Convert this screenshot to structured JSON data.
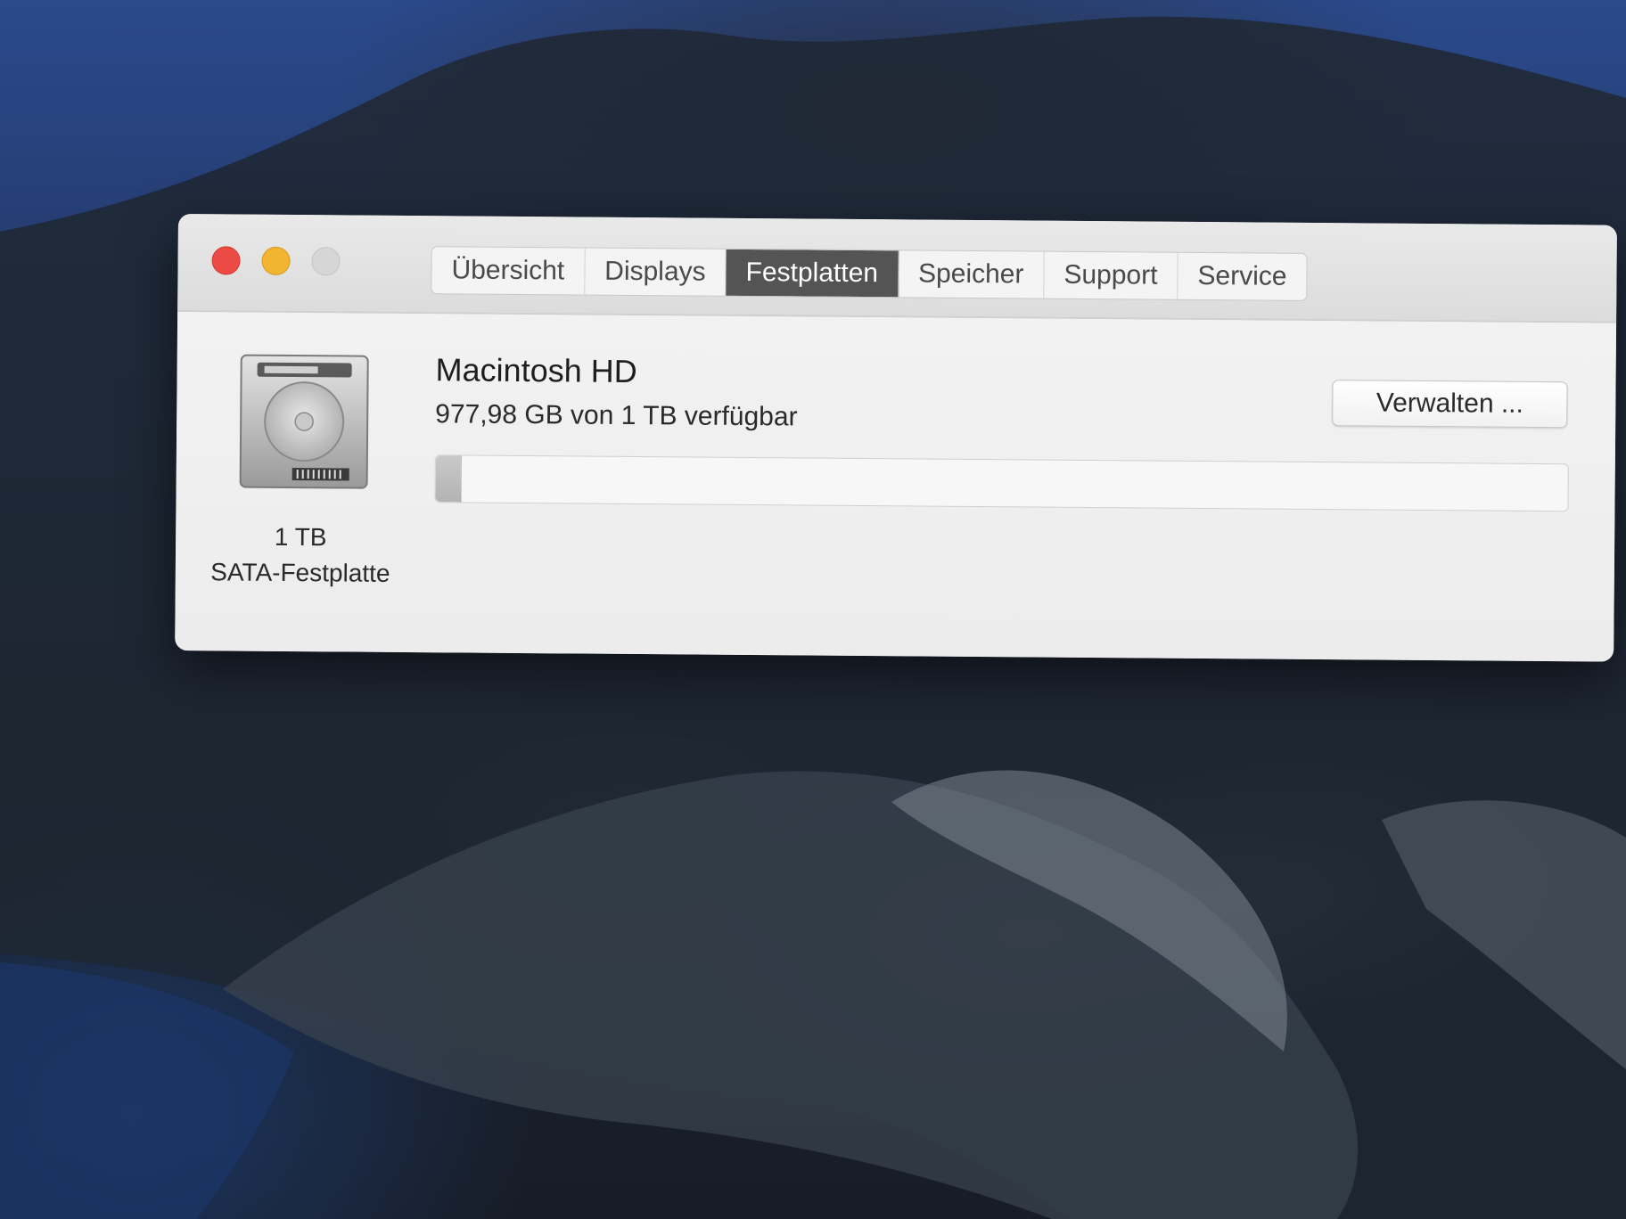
{
  "window": {
    "tabs": [
      {
        "label": "Übersicht",
        "active": false
      },
      {
        "label": "Displays",
        "active": false
      },
      {
        "label": "Festplatten",
        "active": true
      },
      {
        "label": "Speicher",
        "active": false
      },
      {
        "label": "Support",
        "active": false
      },
      {
        "label": "Service",
        "active": false
      }
    ]
  },
  "disk": {
    "icon": "hard-disk-icon",
    "size_label": "1 TB",
    "type_label": "SATA-Festplatte"
  },
  "volume": {
    "name": "Macintosh HD",
    "availability": "977,98 GB von 1 TB verfügbar",
    "used_fraction": 0.022,
    "manage_button_label": "Verwalten ..."
  },
  "colors": {
    "close": "#ec4b45",
    "minimize": "#f1b531",
    "zoom_disabled": "#d6d6d6",
    "active_tab": "#545454"
  }
}
